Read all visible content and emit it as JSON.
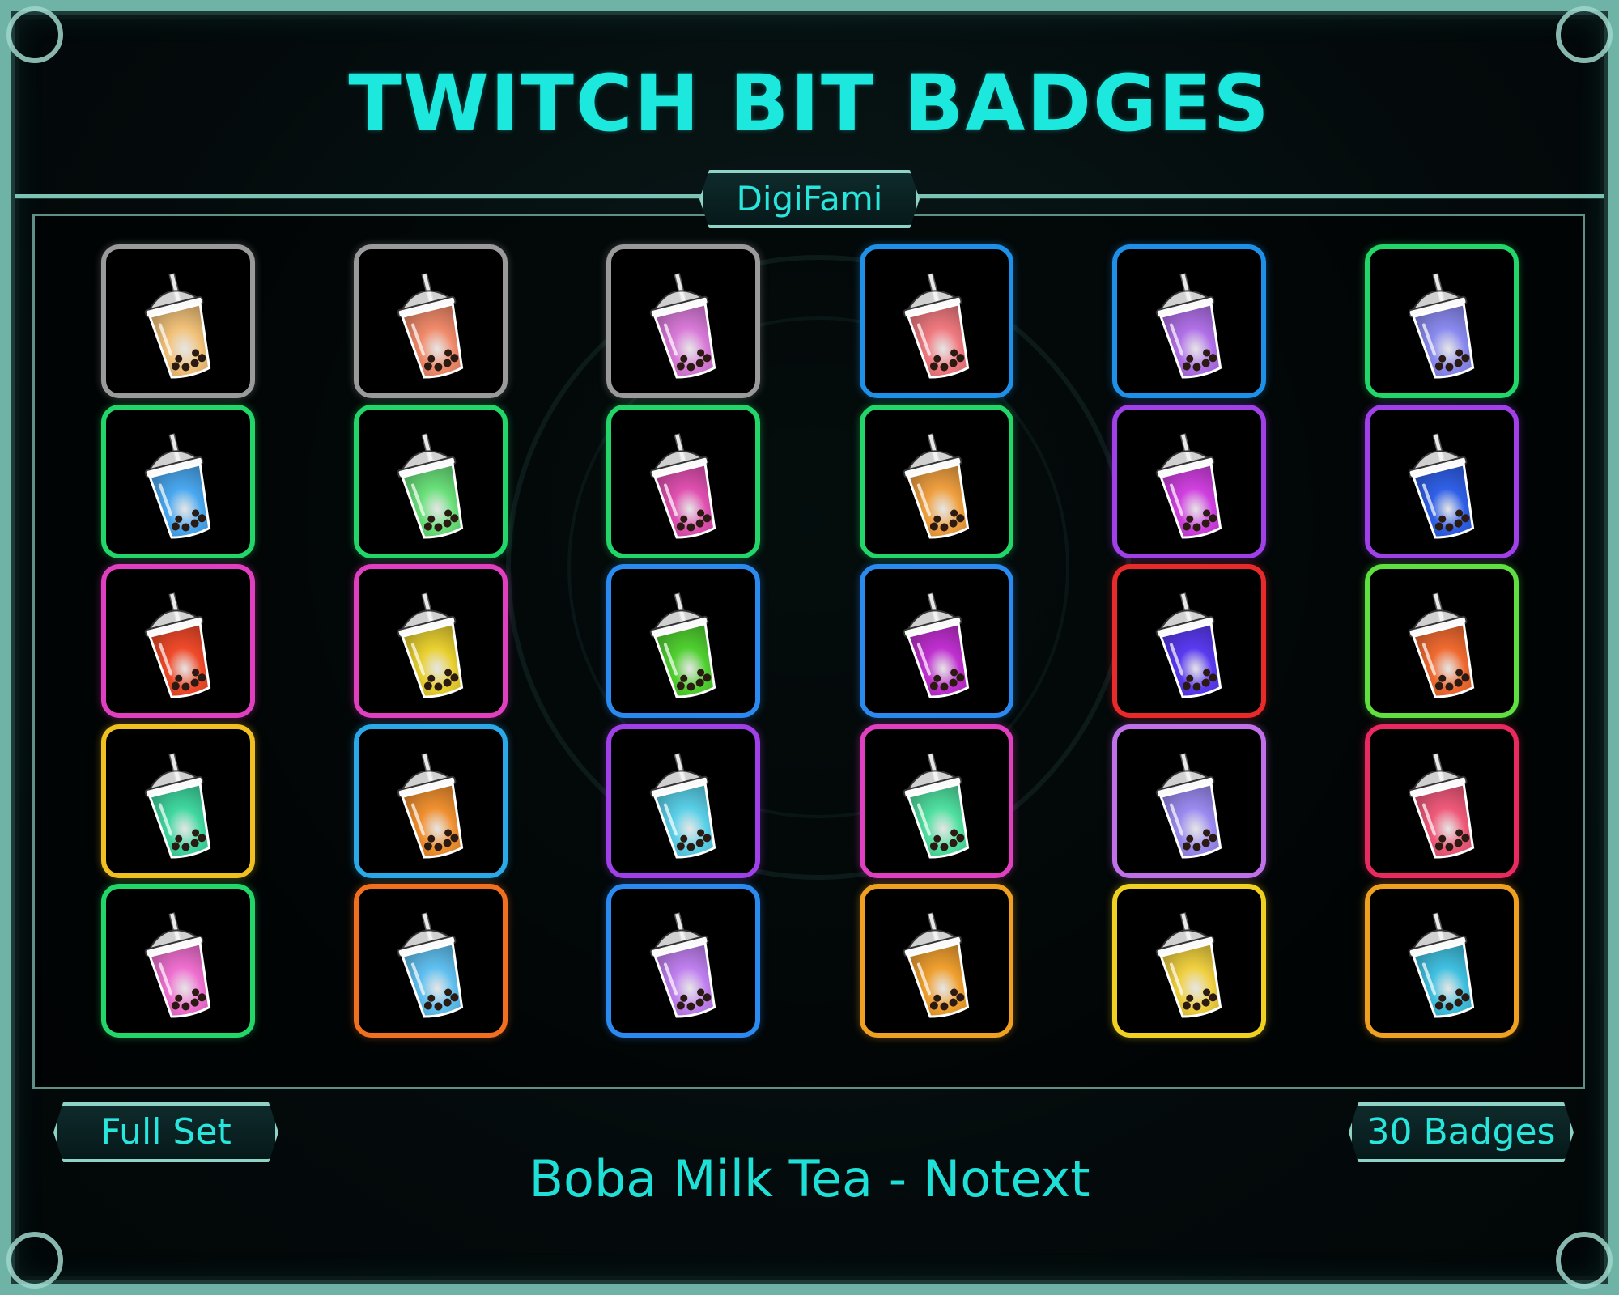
{
  "title": "TWITCH BIT BADGES",
  "author": "DigiFami",
  "left_plate": "Full Set",
  "right_plate": "30 Badges",
  "caption": "Boba Milk Tea - Notext",
  "badges": [
    {
      "border": "#9a9a9a",
      "tea": "#f2c27a"
    },
    {
      "border": "#9a9a9a",
      "tea": "#f08a6a"
    },
    {
      "border": "#9a9a9a",
      "tea": "#d97ad9"
    },
    {
      "border": "#1e90e8",
      "tea": "#f07a80"
    },
    {
      "border": "#1e90e8",
      "tea": "#b070e8"
    },
    {
      "border": "#22d66a",
      "tea": "#8a8af0"
    },
    {
      "border": "#22d66a",
      "tea": "#4aa8f0"
    },
    {
      "border": "#22d66a",
      "tea": "#6ae07a"
    },
    {
      "border": "#22d66a",
      "tea": "#e050b0"
    },
    {
      "border": "#22d66a",
      "tea": "#f0a040"
    },
    {
      "border": "#a040e8",
      "tea": "#d040e0"
    },
    {
      "border": "#a040e8",
      "tea": "#3060e8"
    },
    {
      "border": "#e040c0",
      "tea": "#f04a2a"
    },
    {
      "border": "#e040c0",
      "tea": "#e8d030"
    },
    {
      "border": "#2a8af0",
      "tea": "#50d030"
    },
    {
      "border": "#2a8af0",
      "tea": "#c030d0"
    },
    {
      "border": "#e82a2a",
      "tea": "#5a3af0"
    },
    {
      "border": "#60e040",
      "tea": "#f06a30"
    },
    {
      "border": "#f0c020",
      "tea": "#40d8a0"
    },
    {
      "border": "#2aa8e8",
      "tea": "#f09030"
    },
    {
      "border": "#a040e8",
      "tea": "#5ad0e8"
    },
    {
      "border": "#e040c0",
      "tea": "#50e0a0"
    },
    {
      "border": "#c070e8",
      "tea": "#9a8af0"
    },
    {
      "border": "#e82a60",
      "tea": "#f05a7a"
    },
    {
      "border": "#22d66a",
      "tea": "#f070d0"
    },
    {
      "border": "#f07020",
      "tea": "#60c0f0"
    },
    {
      "border": "#2a8af0",
      "tea": "#c080f0"
    },
    {
      "border": "#f0a020",
      "tea": "#f0a030"
    },
    {
      "border": "#f0d020",
      "tea": "#f0d040"
    },
    {
      "border": "#f0a020",
      "tea": "#40c0e0"
    }
  ]
}
